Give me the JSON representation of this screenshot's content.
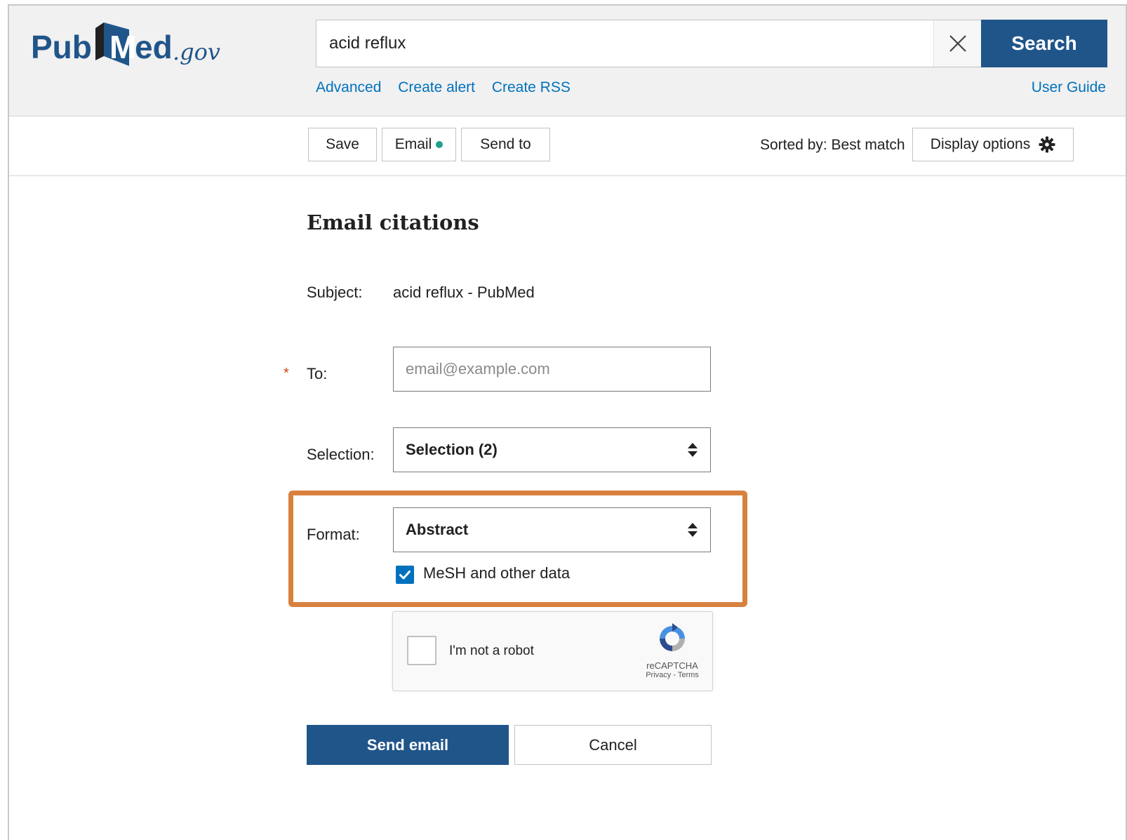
{
  "logo": {
    "text_pub": "Pub",
    "text_med": "Med",
    "text_gov": ".gov"
  },
  "search": {
    "value": "acid reflux",
    "button_label": "Search"
  },
  "search_links": {
    "advanced": "Advanced",
    "create_alert": "Create alert",
    "create_rss": "Create RSS",
    "user_guide": "User Guide"
  },
  "toolbar": {
    "save": "Save",
    "email": "Email",
    "send_to": "Send to",
    "sorted_by": "Sorted by: Best match",
    "display_options": "Display options"
  },
  "form": {
    "title": "Email citations",
    "subject_label": "Subject:",
    "subject_value": "acid reflux - PubMed",
    "required_marker": "*",
    "to_label": "To:",
    "to_placeholder": "email@example.com",
    "selection_label": "Selection:",
    "selection_value": "Selection (2)",
    "format_label": "Format:",
    "format_value": "Abstract",
    "mesh_label": "MeSH and other data",
    "mesh_checked": true
  },
  "recaptcha": {
    "label": "I'm not a robot",
    "brand": "reCAPTCHA",
    "links": "Privacy - Terms"
  },
  "actions": {
    "send": "Send email",
    "cancel": "Cancel"
  },
  "colors": {
    "primary": "#20558a",
    "link": "#0071bc",
    "highlight": "#d8813f",
    "email_dot": "#20a18c"
  }
}
